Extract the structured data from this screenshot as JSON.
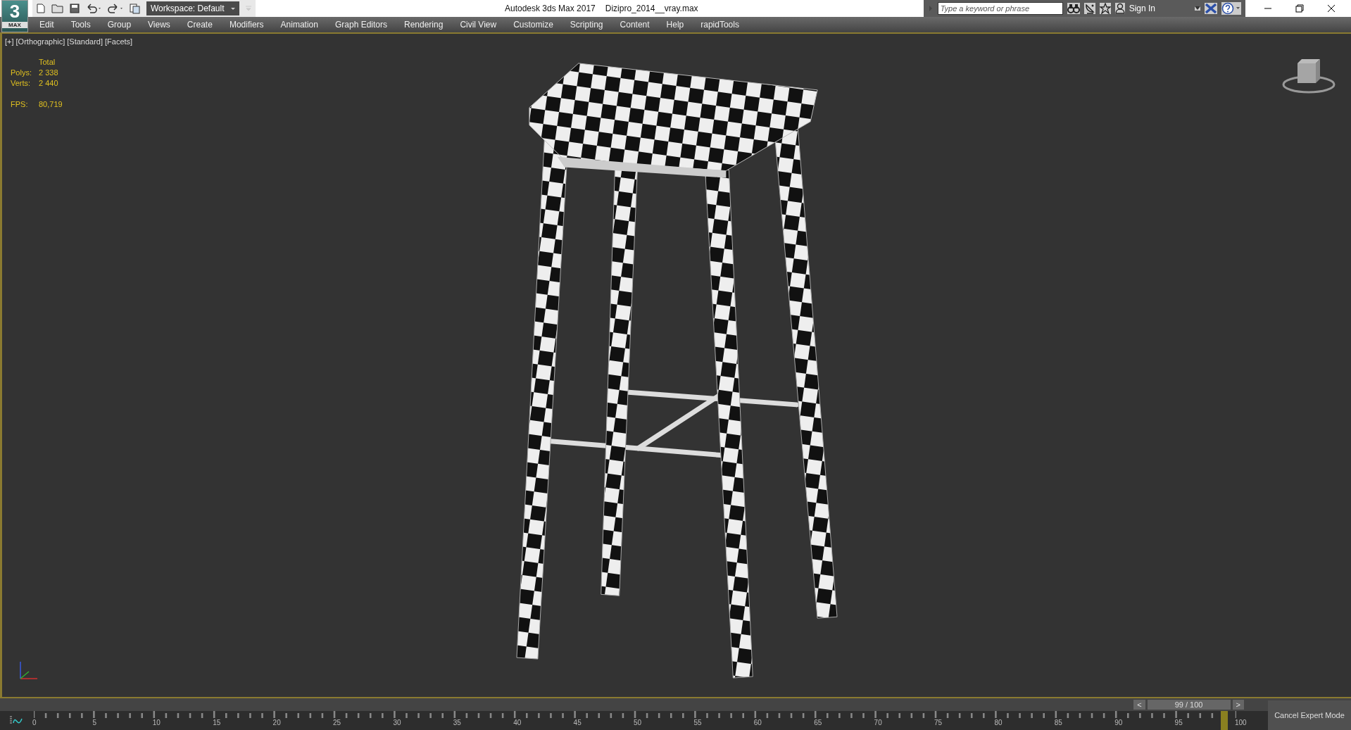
{
  "app": {
    "logo": "3",
    "logo_sub": "MAX",
    "title": "Autodesk 3ds Max 2017",
    "file": "Dizipro_2014__vray.max"
  },
  "toolbar": {
    "workspace": "Workspace: Default"
  },
  "search": {
    "placeholder": "Type a keyword or phrase"
  },
  "account": {
    "label": "Sign In"
  },
  "menu": [
    "Edit",
    "Tools",
    "Group",
    "Views",
    "Create",
    "Modifiers",
    "Animation",
    "Graph Editors",
    "Rendering",
    "Civil View",
    "Customize",
    "Scripting",
    "Content",
    "Help",
    "rapidTools"
  ],
  "viewport": {
    "labels": [
      "[+]",
      "[Orthographic]",
      "[Standard]",
      "[Facets]"
    ],
    "stats": {
      "header": "Total",
      "rows": [
        {
          "label": "Polys:",
          "value": "2 338"
        },
        {
          "label": "Verts:",
          "value": "2 440"
        }
      ],
      "fps_label": "FPS:",
      "fps_value": "80,719"
    }
  },
  "timeline": {
    "prev": "<",
    "frame": "99 / 100",
    "next": ">",
    "level": 0.99,
    "ticks": [
      "0",
      "5",
      "10",
      "15",
      "20",
      "25",
      "30",
      "35",
      "40",
      "45",
      "50",
      "55",
      "60",
      "65",
      "70",
      "75",
      "80",
      "85",
      "90",
      "95",
      "100"
    ]
  },
  "expert_button": "Cancel Expert Mode"
}
